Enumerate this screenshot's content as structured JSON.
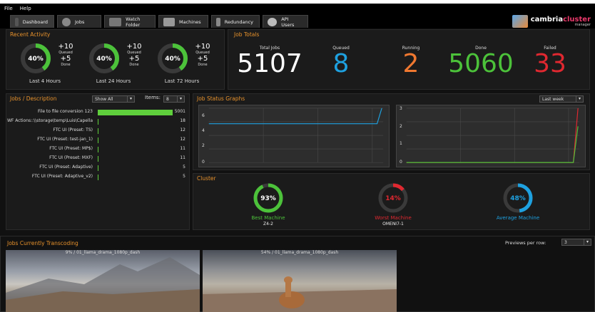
{
  "menu": [
    "File",
    "Help"
  ],
  "tabs": [
    {
      "label": "Dashboard",
      "icon": "cloud-icon"
    },
    {
      "label": "Jobs",
      "icon": "refresh-icon"
    },
    {
      "label": "Watch Folder",
      "icon": "folder-icon"
    },
    {
      "label": "Machines",
      "icon": "monitor-icon"
    },
    {
      "label": "Redundancy",
      "icon": "database-icon"
    },
    {
      "label": "API Users",
      "icon": "user-icon"
    }
  ],
  "logo": {
    "brand": "cambria",
    "brand_accent": "cluster",
    "sub": "manager"
  },
  "recent_activity": {
    "title": "Recent Activity",
    "blocks": [
      {
        "percent": 40,
        "pct_text": "40%",
        "queued": "+10",
        "queued_label": "Queued",
        "done": "+5",
        "done_label": "Done",
        "period": "Last 4 Hours"
      },
      {
        "percent": 40,
        "pct_text": "40%",
        "queued": "+10",
        "queued_label": "Queued",
        "done": "+5",
        "done_label": "Done",
        "period": "Last 24 Hours"
      },
      {
        "percent": 40,
        "pct_text": "40%",
        "queued": "+10",
        "queued_label": "Queued",
        "done": "+5",
        "done_label": "Done",
        "period": "Last 72 Hours"
      }
    ]
  },
  "job_totals": {
    "title": "Job Totals",
    "items": [
      {
        "label": "Total Jobs",
        "value": "5107",
        "color": "#ffffff"
      },
      {
        "label": "Queued",
        "value": "8",
        "color": "#1ea1e0"
      },
      {
        "label": "Running",
        "value": "2",
        "color": "#f07830"
      },
      {
        "label": "Done",
        "value": "5060",
        "color": "#4cc23a"
      },
      {
        "label": "Failed",
        "value": "33",
        "color": "#e02830"
      }
    ]
  },
  "jobs_desc": {
    "title": "Jobs / Description",
    "filter": "Show All",
    "items_label": "Items:",
    "items_value": "8",
    "rows": [
      {
        "label": "File to file conversion 123",
        "count": 5001
      },
      {
        "label": "WF Actions::\\\\storage\\temp\\Luis\\Capella",
        "count": 18
      },
      {
        "label": "FTC UI (Preset: TS)",
        "count": 12
      },
      {
        "label": "FTC UI (Preset: test-jan_1)",
        "count": 12
      },
      {
        "label": "FTC UI (Preset: MP$)",
        "count": 11
      },
      {
        "label": "FTC UI (Preset: MXF)",
        "count": 11
      },
      {
        "label": "FTC UI (Preset: Adaptive)",
        "count": 5
      },
      {
        "label": "FTC UI (Preset: Adaptive_v2)",
        "count": 5
      }
    ]
  },
  "status_graphs": {
    "title": "Job Status Graphs",
    "range": "Last week",
    "left_ticks": [
      "6",
      "4",
      "2",
      "0"
    ],
    "right_ticks": [
      "3",
      "2",
      "1",
      "0"
    ]
  },
  "chart_data": [
    {
      "type": "line",
      "ylim": [
        0,
        7
      ],
      "series": [
        {
          "values": [
            5,
            5,
            5,
            5,
            5,
            5,
            5,
            5,
            7
          ]
        }
      ]
    },
    {
      "type": "line",
      "ylim": [
        0,
        3
      ],
      "series": [
        {
          "values": [
            0,
            0,
            0,
            0,
            0,
            0,
            0,
            0,
            3
          ]
        },
        {
          "values": [
            0,
            0,
            0,
            0,
            0,
            0,
            0,
            0,
            2
          ]
        }
      ]
    }
  ],
  "cluster": {
    "title": "Cluster",
    "items": [
      {
        "percent": 93,
        "pct_text": "93%",
        "label": "Best Machine",
        "machine": "Z4-2",
        "color": "#4cc23a"
      },
      {
        "percent": 14,
        "pct_text": "14%",
        "label": "Worst Machine",
        "machine": "OMENI7-1",
        "color": "#e02830"
      },
      {
        "percent": 48,
        "pct_text": "48%",
        "label": "Average Machine",
        "machine": "",
        "color": "#1ea1e0"
      }
    ]
  },
  "transcoding": {
    "title": "Jobs Currently Transcoding",
    "previews_label": "Previews per row:",
    "previews_value": "3",
    "items": [
      {
        "title": "9% / 01_llama_drama_1080p_dash"
      },
      {
        "title": "54% / 01_llama_drama_1080p_dash"
      }
    ]
  }
}
